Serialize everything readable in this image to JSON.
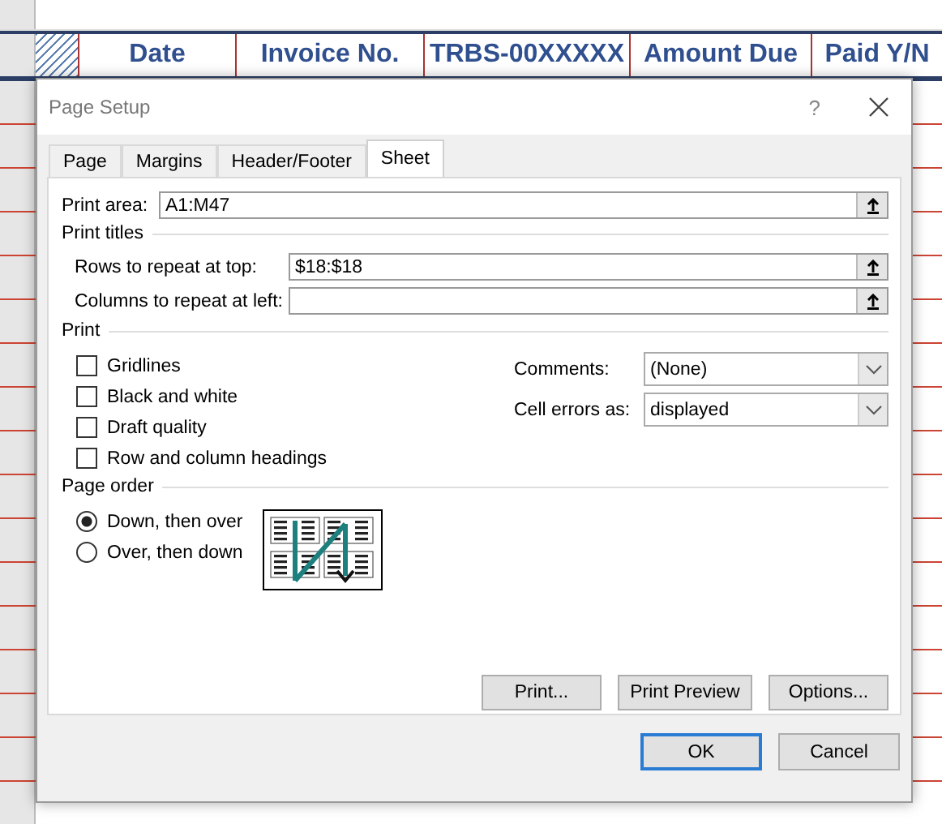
{
  "sheet": {
    "headers": [
      "Date",
      "Invoice No.",
      "TRBS-00XXXXX",
      "Amount Due",
      "Paid Y/N"
    ]
  },
  "dialog": {
    "title": "Page Setup",
    "help": "?",
    "tabs": [
      {
        "label": "Page",
        "selected": false
      },
      {
        "label": "Margins",
        "selected": false
      },
      {
        "label": "Header/Footer",
        "selected": false
      },
      {
        "label": "Sheet",
        "selected": true
      }
    ],
    "print_area": {
      "label": "Print area:",
      "value": "A1:M47"
    },
    "print_titles": {
      "title": "Print titles",
      "fields": [
        {
          "label": "Rows to repeat at top:",
          "value": "$18:$18"
        },
        {
          "label": "Columns to repeat at left:"
        }
      ]
    },
    "print": {
      "title": "Print",
      "checkboxes": [
        {
          "label": "Gridlines",
          "checked": false
        },
        {
          "label": "Black and white",
          "checked": false
        },
        {
          "label": "Draft quality",
          "checked": false
        },
        {
          "label": "Row and column headings",
          "checked": false
        }
      ],
      "dropdowns": [
        {
          "label": "Comments:",
          "value": "(None)"
        },
        {
          "label": "Cell errors as:",
          "value": "displayed"
        }
      ]
    },
    "page_order": {
      "title": "Page order",
      "options": [
        {
          "label": "Down, then over",
          "selected": true
        },
        {
          "label": "Over, then down",
          "selected": false
        }
      ]
    },
    "panel_buttons": [
      "Print...",
      "Print Preview",
      "Options..."
    ],
    "footer_buttons": [
      {
        "label": "OK",
        "default": true
      },
      {
        "label": "Cancel",
        "default": false
      }
    ]
  }
}
